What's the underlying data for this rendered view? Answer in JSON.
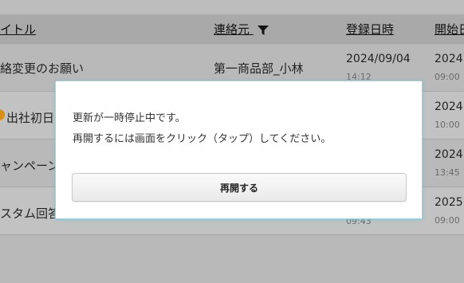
{
  "table": {
    "headers": {
      "title": "イトル",
      "contact": "連絡元",
      "registered": "登録日時",
      "start": "開始日"
    },
    "rows": [
      {
        "title": "絡変更のお願い",
        "contact": "第一商品部_小林",
        "registered_date": "2024/09/04",
        "registered_time": "14:12",
        "start_date": "2024",
        "start_time": "09:00"
      },
      {
        "title": "出社初日の",
        "contact": "",
        "registered_date": "",
        "registered_time": "",
        "start_date": "2024",
        "start_time": "10:00"
      },
      {
        "title": "ャンペーン",
        "contact": "",
        "registered_date": "",
        "registered_time": "",
        "start_date": "2024",
        "start_time": "13:45"
      },
      {
        "title": "スタム回答",
        "contact": "",
        "registered_date": "",
        "registered_time": "09:43",
        "start_date": "2025",
        "start_time": "09:00"
      }
    ]
  },
  "dialog": {
    "line1": "更新が一時停止中です。",
    "line2": "再開するには画面をクリック（タップ）してください。",
    "button": "再開する"
  },
  "icons": {
    "filter": "filter-icon"
  },
  "colors": {
    "overlay_bg": "#b9b9b9",
    "header_bg": "#a9a9a9",
    "dialog_border": "#9ad2de",
    "badge": "#d89018"
  }
}
